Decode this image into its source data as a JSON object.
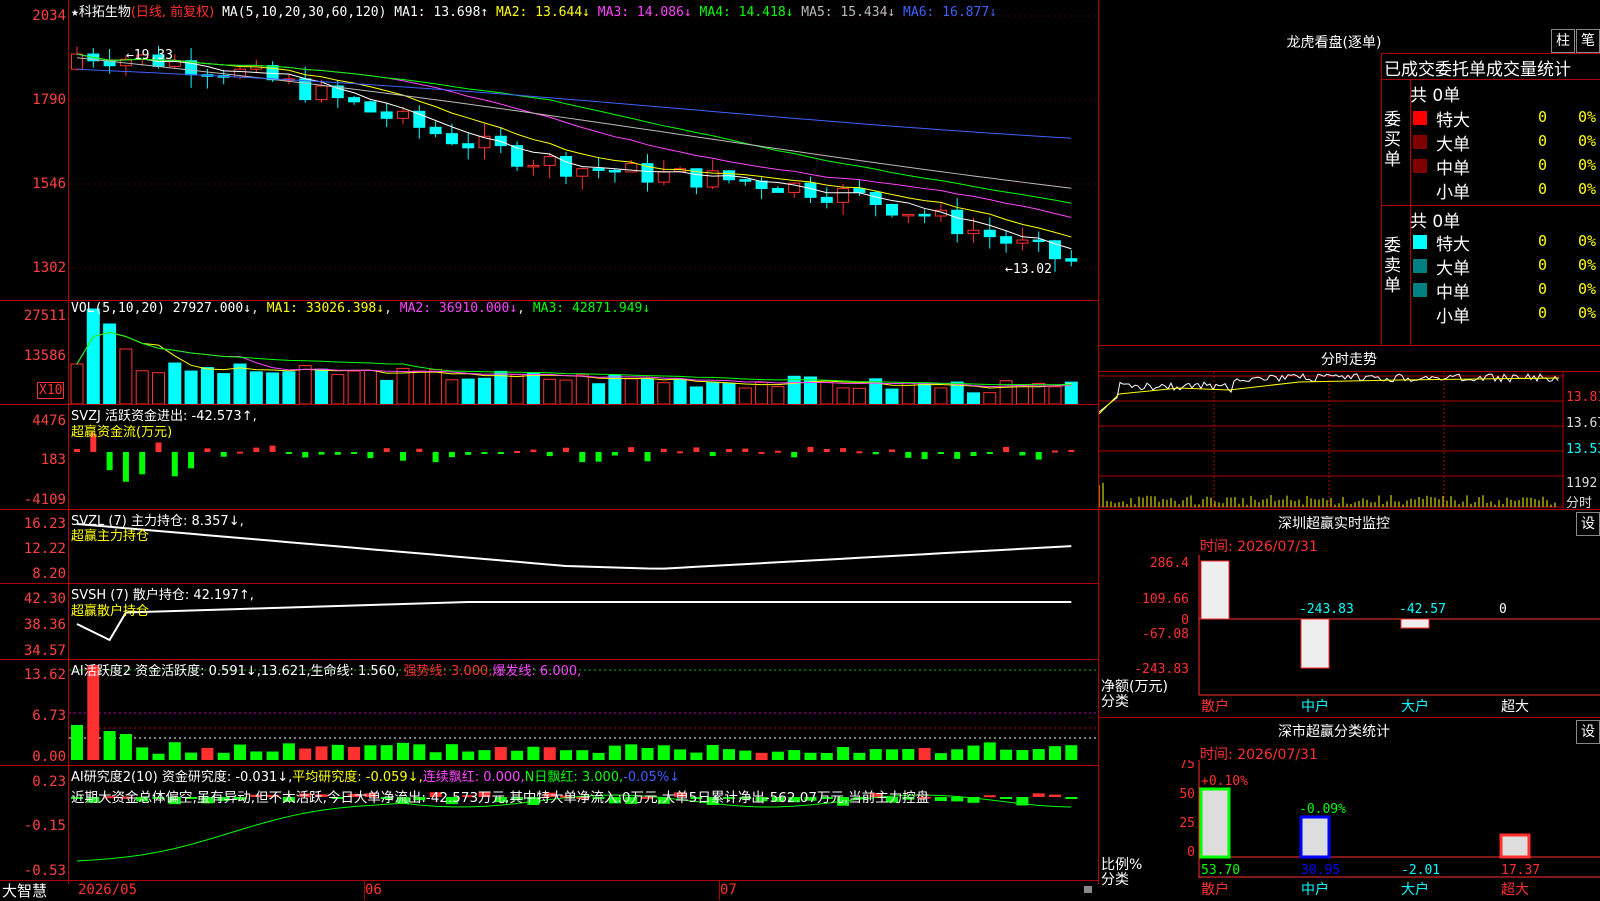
{
  "colors": {
    "border": "#b00000",
    "up": "#ff3030",
    "down": "#00ffff",
    "ma1": "#ffffff",
    "ma2": "#ffff00",
    "ma3": "#ff44ff",
    "ma4": "#00ff00",
    "ma5": "#bbbbbb",
    "ma6": "#4060ff"
  },
  "main": {
    "stock_name": "科拓生物",
    "mode": "(日线, 前复权)",
    "ma_params": "MA(5,10,20,30,60,120)",
    "ma1": "MA1: 13.698↑",
    "ma2": "MA2: 13.644↓",
    "ma3": "MA3: 14.086↓",
    "ma4": "MA4: 14.418↓",
    "ma5": "MA5: 15.434↓",
    "ma6": "MA6: 16.877↓",
    "axis": [
      "2034",
      "1790",
      "1546",
      "1302"
    ],
    "high_label": "19.33",
    "low_label": "13.02"
  },
  "vol": {
    "title": "VOL(5,10,20)",
    "value": "27927.000↓",
    "ma1": "MA1: 33026.398↓",
    "ma2": "MA2: 36910.000↓",
    "ma3": "MA3: 42871.949↓",
    "axis": [
      "27511",
      "13586"
    ],
    "unit": "X10"
  },
  "svzj": {
    "title": "SVZJ  活跃资金进出: -42.573↑,",
    "subtitle": "超赢资金流(万元)",
    "axis": [
      "4476",
      "183",
      "-4109"
    ]
  },
  "svzl": {
    "title": "SVZL (7) 主力持仓: 8.357↓,",
    "subtitle": "超赢主力持仓",
    "axis": [
      "16.23",
      "12.22",
      "8.20"
    ]
  },
  "svsh": {
    "title": "SVSH (7) 散户持仓: 42.197↑,",
    "subtitle": "超赢散户持仓",
    "axis": [
      "42.30",
      "38.36",
      "34.57"
    ]
  },
  "ai1": {
    "title": "AI活跃度2 资金活跃度: 0.591↓,13.621,",
    "life": "生命线: 1.560,",
    "strong": "强势线: 3.000,",
    "burst": "爆发线: 6.000,",
    "axis": [
      "13.62",
      "6.73",
      "0.00"
    ]
  },
  "ai2": {
    "t1": "AI研究度2(10) 资金研究度: -0.031↓,",
    "t2": "平均研究度: -0.059↓,",
    "t3": "连续飘红: 0.000,",
    "t4": "N日飘红: 3.000,",
    "t5": "-0.05%↓",
    "comment": "近期大资金总体偏空,虽有异动,但不太活跃,今日大单净流出:-42.573万元,其中特大单净流入:0万元,大单5日累计净出-562.07万元,当前主力控盘",
    "axis": [
      "0.23",
      "-0.15",
      "-0.53"
    ]
  },
  "bottom": {
    "logo": "大智慧",
    "dates": [
      "2026/05",
      "06",
      "07"
    ]
  },
  "lhb": {
    "title": "龙虎看盘(逐单)",
    "btn_bar": "柱",
    "btn_pen": "笔",
    "header": "已成交委托单成交量统计",
    "buy": {
      "label": "委买单",
      "total": "共 0单",
      "rows": [
        {
          "name": "特大",
          "n": "0",
          "p": "0%"
        },
        {
          "name": "大单",
          "n": "0",
          "p": "0%"
        },
        {
          "name": "中单",
          "n": "0",
          "p": "0%"
        },
        {
          "name": "小单",
          "n": "0",
          "p": "0%"
        }
      ]
    },
    "sell": {
      "label": "委卖单",
      "total": "共 0单",
      "rows": [
        {
          "name": "特大",
          "n": "0",
          "p": "0%"
        },
        {
          "name": "大单",
          "n": "0",
          "p": "0%"
        },
        {
          "name": "中单",
          "n": "0",
          "p": "0%"
        },
        {
          "name": "小单",
          "n": "0",
          "p": "0%"
        }
      ]
    }
  },
  "intraday": {
    "title": "分时走势",
    "axis": [
      "13.81",
      "13.67",
      "13.53",
      "1192"
    ],
    "unit": "分时"
  },
  "monitor": {
    "title": "深圳超赢实时监控",
    "btn": "设",
    "time": "时间: 2026/07/31",
    "axis": [
      "286.4",
      "109.66",
      "0",
      "-67.08",
      "-243.83"
    ],
    "ylabel": "净额(万元)",
    "xlabel": "分类",
    "cats": [
      "散户",
      "中户",
      "大户",
      "超大"
    ],
    "values": [
      "286.4",
      "-243.83",
      "-42.57",
      "0"
    ]
  },
  "classify": {
    "title": "深市超赢分类统计",
    "btn": "设",
    "time": "时间: 2026/07/31",
    "axis": [
      "75",
      "50",
      "25",
      "0"
    ],
    "ylabel": "比例%",
    "xlabel": "分类",
    "cats": [
      "散户",
      "中户",
      "大户",
      "超大"
    ],
    "pct_top": [
      "+0.10%",
      "-0.09%"
    ],
    "values": [
      "53.70",
      "30.95",
      "-2.01",
      "17.37"
    ]
  }
}
